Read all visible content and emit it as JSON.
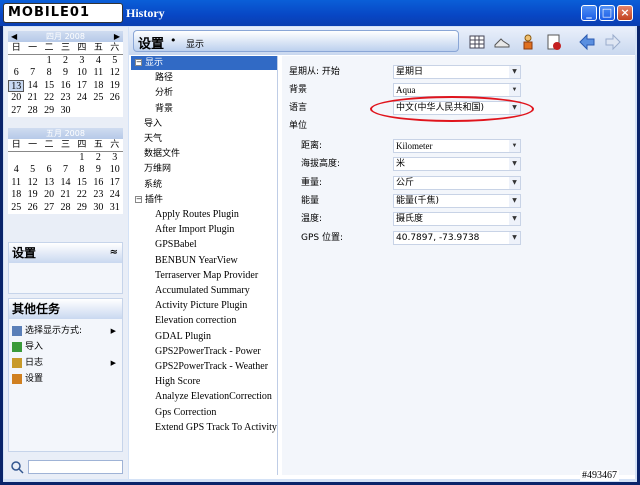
{
  "app": {
    "logo_text": "MOBILE01",
    "window_title": "History"
  },
  "calendar": [
    {
      "month_label": "四月 2008",
      "dow": [
        "日",
        "一",
        "二",
        "三",
        "四",
        "五",
        "六"
      ],
      "weeks": [
        [
          "",
          "",
          "1",
          "2",
          "3",
          "4",
          "5"
        ],
        [
          "6",
          "7",
          "8",
          "9",
          "10",
          "11",
          "12"
        ],
        [
          "13",
          "14",
          "15",
          "16",
          "17",
          "18",
          "19"
        ],
        [
          "20",
          "21",
          "22",
          "23",
          "24",
          "25",
          "26"
        ],
        [
          "27",
          "28",
          "29",
          "30",
          "",
          "",
          ""
        ]
      ],
      "today": "13"
    },
    {
      "month_label": "五月 2008",
      "dow": [
        "日",
        "一",
        "二",
        "三",
        "四",
        "五",
        "六"
      ],
      "weeks": [
        [
          "",
          "",
          "",
          "",
          "1",
          "2",
          "3"
        ],
        [
          "4",
          "5",
          "6",
          "7",
          "8",
          "9",
          "10"
        ],
        [
          "11",
          "12",
          "13",
          "14",
          "15",
          "16",
          "17"
        ],
        [
          "18",
          "19",
          "20",
          "21",
          "22",
          "23",
          "24"
        ],
        [
          "25",
          "26",
          "27",
          "28",
          "29",
          "30",
          "31"
        ]
      ]
    }
  ],
  "panels": {
    "settings_title": "设置",
    "tasks_title": "其他任务",
    "tasks": [
      {
        "label": "选择显示方式:",
        "arrow": true
      },
      {
        "label": "导入",
        "arrow": false
      },
      {
        "label": "日志",
        "arrow": true
      },
      {
        "label": "设置",
        "arrow": false
      }
    ]
  },
  "header": {
    "title": "设置",
    "bullet": "•",
    "subtitle": "显示"
  },
  "tree": [
    {
      "label": "显示",
      "depth": 0,
      "expander": "−",
      "selected": true
    },
    {
      "label": "路径",
      "depth": 2
    },
    {
      "label": "分析",
      "depth": 2
    },
    {
      "label": "背景",
      "depth": 2
    },
    {
      "label": "导入",
      "depth": 1
    },
    {
      "label": "天气",
      "depth": 1
    },
    {
      "label": "数据文件",
      "depth": 1
    },
    {
      "label": "万维网",
      "depth": 1
    },
    {
      "label": "系统",
      "depth": 1
    },
    {
      "label": "插件",
      "depth": 0,
      "expander": "−"
    },
    {
      "label": "Apply Routes Plugin",
      "depth": 2,
      "serif": true
    },
    {
      "label": "After Import Plugin",
      "depth": 2,
      "serif": true
    },
    {
      "label": "GPSBabel",
      "depth": 2,
      "serif": true
    },
    {
      "label": "BENBUN YearView",
      "depth": 2,
      "serif": true
    },
    {
      "label": "Terraserver Map Provider",
      "depth": 2,
      "serif": true
    },
    {
      "label": "Accumulated Summary",
      "depth": 2,
      "serif": true
    },
    {
      "label": "Activity Picture Plugin",
      "depth": 2,
      "serif": true
    },
    {
      "label": "Elevation correction",
      "depth": 2,
      "serif": true
    },
    {
      "label": "GDAL Plugin",
      "depth": 2,
      "serif": true
    },
    {
      "label": "GPS2PowerTrack - Power",
      "depth": 2,
      "serif": true
    },
    {
      "label": "GPS2PowerTrack - Weather",
      "depth": 2,
      "serif": true
    },
    {
      "label": "High Score",
      "depth": 2,
      "serif": true
    },
    {
      "label": "Analyze ElevationCorrection",
      "depth": 2,
      "serif": true
    },
    {
      "label": "Gps Correction",
      "depth": 2,
      "serif": true
    },
    {
      "label": "Extend GPS Track To Activity",
      "depth": 2,
      "serif": true
    }
  ],
  "settings": {
    "week_start_label": "星期从: 开始",
    "week_start_value": "星期日",
    "background_label": "背景",
    "background_value": "Aqua",
    "language_label": "语言",
    "language_value": "中文(中华人民共和国)",
    "units_label": "单位",
    "units": [
      {
        "label": "距离:",
        "value": "Kilometer",
        "serif": true
      },
      {
        "label": "海拔高度:",
        "value": "米"
      },
      {
        "label": "重量:",
        "value": "公斤"
      },
      {
        "label": "能量",
        "value": "能量(千焦)"
      },
      {
        "label": "温度:",
        "value": "摄氏度"
      },
      {
        "label": "GPS 位置:",
        "value": "40.7897, -73.9738"
      }
    ]
  },
  "watermark": "#493467",
  "colors": {
    "title_bar": "#0846c4",
    "selection": "#316ac5",
    "annotation_ring": "#e0141c"
  }
}
